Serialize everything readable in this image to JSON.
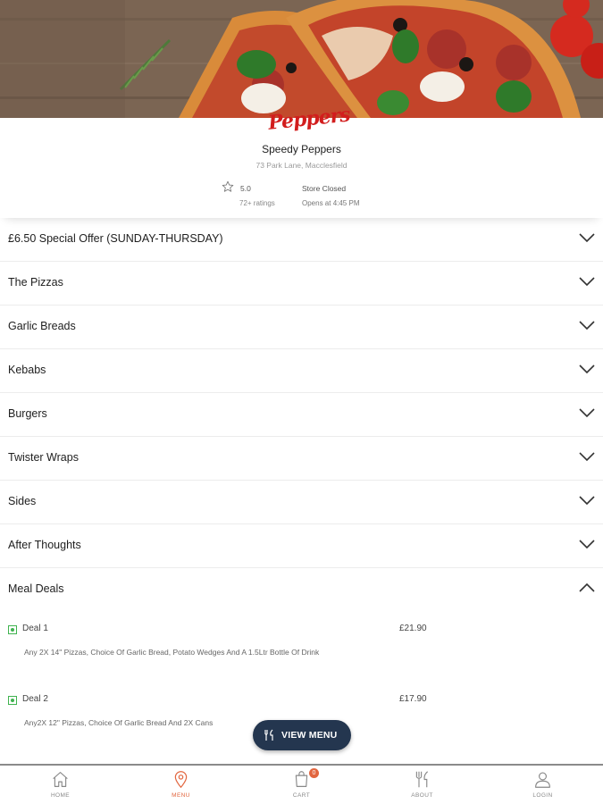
{
  "app": {
    "logo_text": "Peppers"
  },
  "shop": {
    "name": "Speedy Peppers",
    "address": "73 Park Lane, Macclesfield",
    "rating": "5.0",
    "rating_count": "72+ ratings",
    "status": "Store Closed",
    "opens": "Opens at 4:45 PM"
  },
  "categories": [
    {
      "label": "£6.50 Special Offer (SUNDAY-THURSDAY)",
      "expanded": false
    },
    {
      "label": "The Pizzas",
      "expanded": false
    },
    {
      "label": "Garlic Breads",
      "expanded": false
    },
    {
      "label": "Kebabs",
      "expanded": false
    },
    {
      "label": "Burgers",
      "expanded": false
    },
    {
      "label": "Twister Wraps",
      "expanded": false
    },
    {
      "label": "Sides",
      "expanded": false
    },
    {
      "label": "After Thoughts",
      "expanded": false
    },
    {
      "label": "Meal Deals",
      "expanded": true
    }
  ],
  "deals": [
    {
      "name": "Deal 1",
      "price": "£21.90",
      "description": "Any 2X 14\" Pizzas, Choice Of Garlic Bread, Potato Wedges And A 1.5Ltr Bottle Of Drink"
    },
    {
      "name": "Deal 2",
      "price": "£17.90",
      "description": "Any2X 12\" Pizzas, Choice Of Garlic Bread And 2X Cans"
    }
  ],
  "view_menu_label": "VIEW MENU",
  "tabs": [
    {
      "label": "HOME",
      "icon": "home-icon",
      "active": false
    },
    {
      "label": "MENU",
      "icon": "location-pin-icon",
      "active": true
    },
    {
      "label": "CART",
      "icon": "cart-icon",
      "active": false,
      "badge": "0"
    },
    {
      "label": "ABOUT",
      "icon": "cutlery-icon",
      "active": false
    },
    {
      "label": "LOGIN",
      "icon": "user-icon",
      "active": false
    }
  ],
  "colors": {
    "accent": "#e2663f",
    "logo_red": "#d21d1d",
    "veg_green": "#3fb34f",
    "button_navy": "#24364f"
  }
}
